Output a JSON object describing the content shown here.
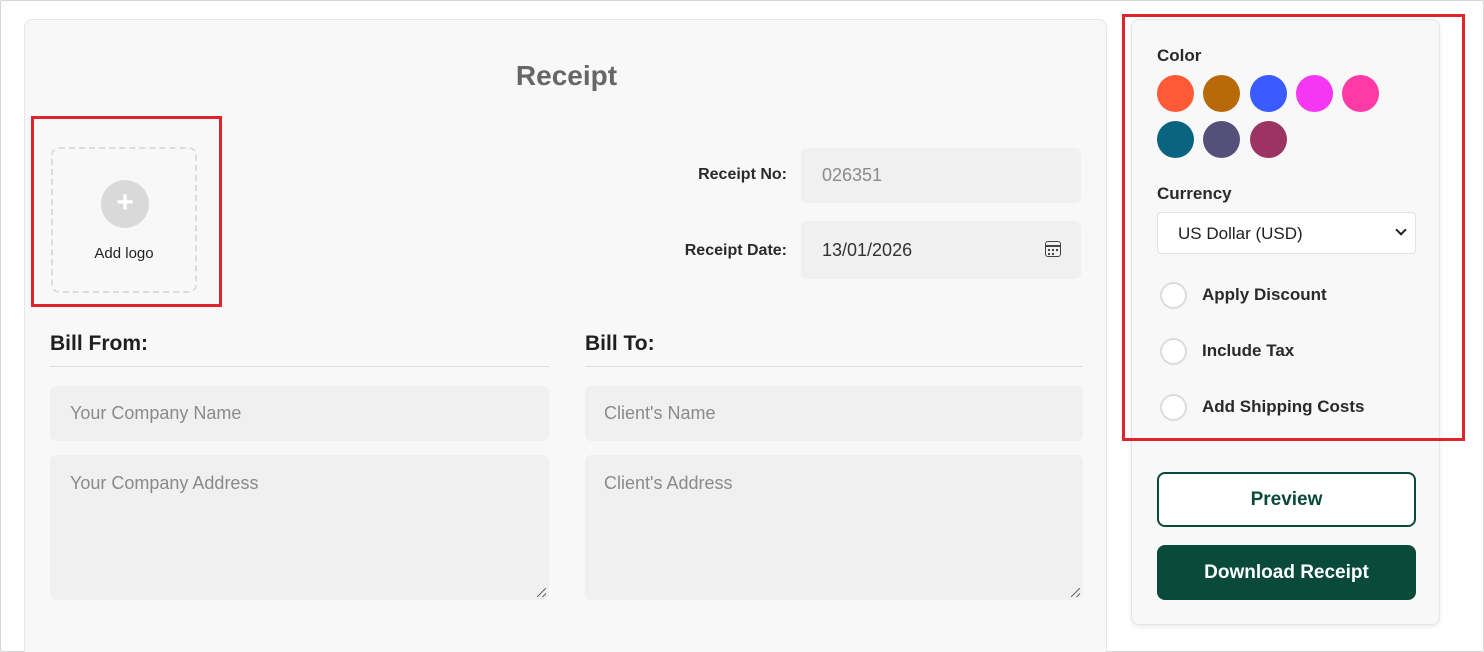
{
  "receipt": {
    "title": "Receipt",
    "logo": {
      "label": "Add logo",
      "icon": "plus-icon"
    },
    "receipt_no": {
      "label": "Receipt No:",
      "placeholder": "026351"
    },
    "receipt_date": {
      "label": "Receipt Date:",
      "value": "13/01/2026",
      "icon": "calendar-icon"
    },
    "bill_from": {
      "heading": "Bill From:",
      "name_placeholder": "Your Company Name",
      "address_placeholder": "Your Company Address"
    },
    "bill_to": {
      "heading": "Bill To:",
      "name_placeholder": "Client's Name",
      "address_placeholder": "Client's Address"
    }
  },
  "settings": {
    "color_label": "Color",
    "colors": [
      "#ff5a36",
      "#b8690a",
      "#3a5bff",
      "#f536f2",
      "#fd3aa6",
      "#0a6480",
      "#555079",
      "#9b3463"
    ],
    "currency_label": "Currency",
    "currency_value": "US Dollar (USD)",
    "options": [
      {
        "label": "Apply Discount",
        "checked": false
      },
      {
        "label": "Include Tax",
        "checked": false
      },
      {
        "label": "Add Shipping Costs",
        "checked": false
      }
    ],
    "preview_label": "Preview",
    "download_label": "Download Receipt"
  },
  "highlight_color": "#e0242b",
  "brand_color": "#0a4a3a"
}
